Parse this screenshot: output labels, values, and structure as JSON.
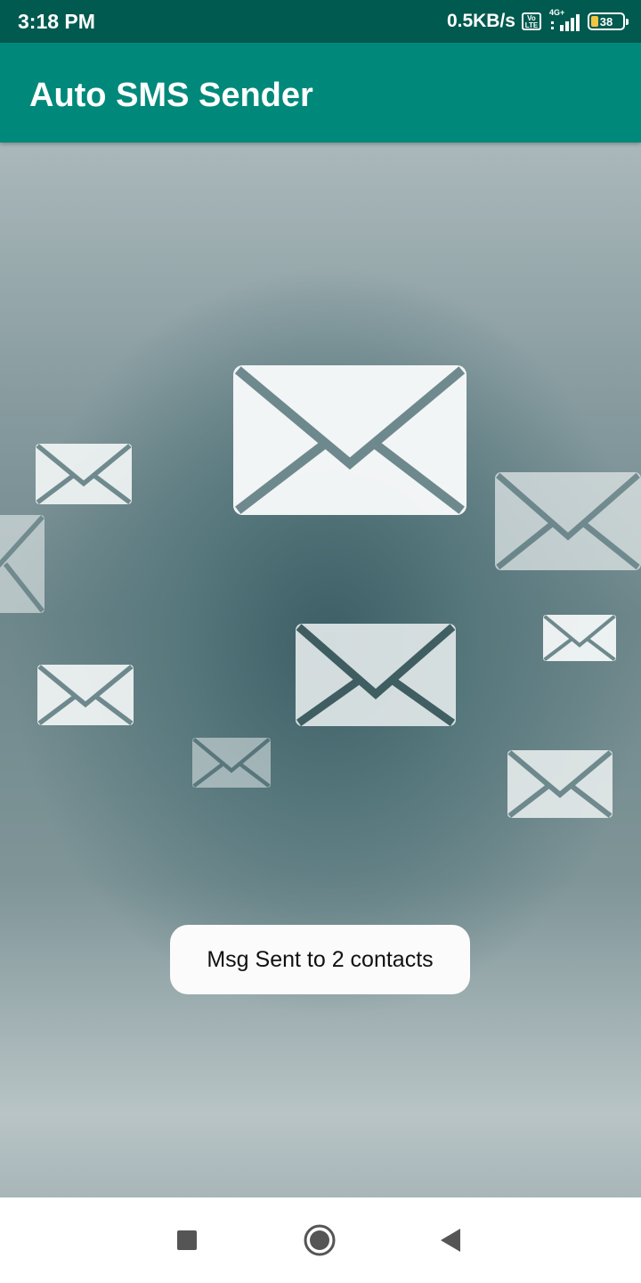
{
  "status_bar": {
    "time": "3:18 PM",
    "net_speed": "0.5KB/s",
    "volte": "Vo LTE",
    "network_type": "4G+",
    "battery_level": "38",
    "icons": [
      "volte-icon",
      "signal-icon",
      "battery-icon"
    ]
  },
  "app_bar": {
    "title": "Auto SMS Sender"
  },
  "background": {
    "icon": "envelope-icon"
  },
  "toast": {
    "message": "Msg Sent to 2 contacts"
  },
  "nav_bar": {
    "icons": [
      "recent-apps-icon",
      "home-icon",
      "back-icon"
    ]
  },
  "colors": {
    "status_bar": "#005a4f",
    "app_bar": "#00897a",
    "accent_battery": "#f4c542"
  }
}
